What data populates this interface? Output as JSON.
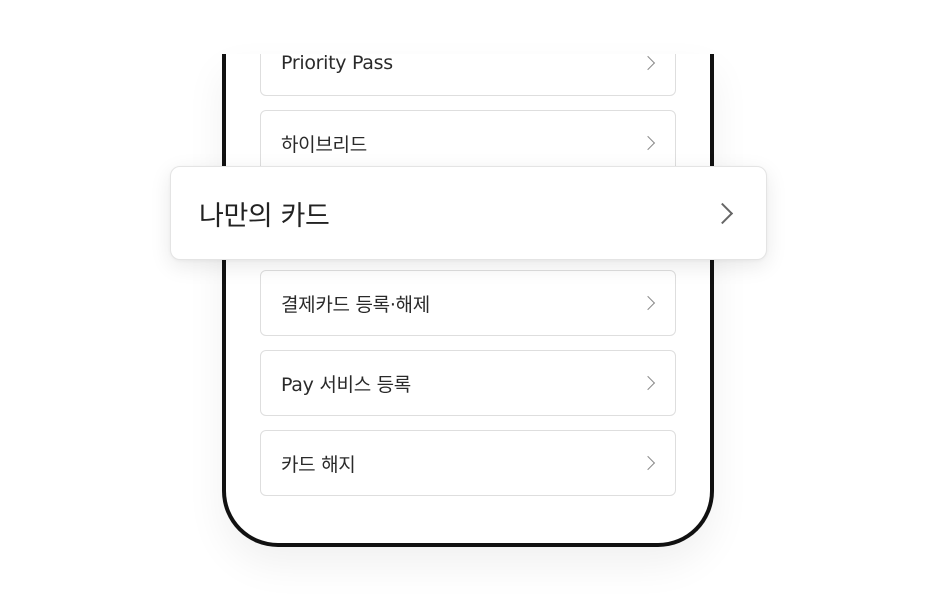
{
  "menu": {
    "items": [
      {
        "label": "Priority Pass"
      },
      {
        "label": "하이브리드"
      },
      {
        "label": "결제카드 등록·해제"
      },
      {
        "label": "Pay 서비스 등록"
      },
      {
        "label": "카드 해지"
      }
    ]
  },
  "highlight": {
    "label": "나만의 카드"
  },
  "icons": {
    "row_chevron": "chevron-right-icon"
  }
}
